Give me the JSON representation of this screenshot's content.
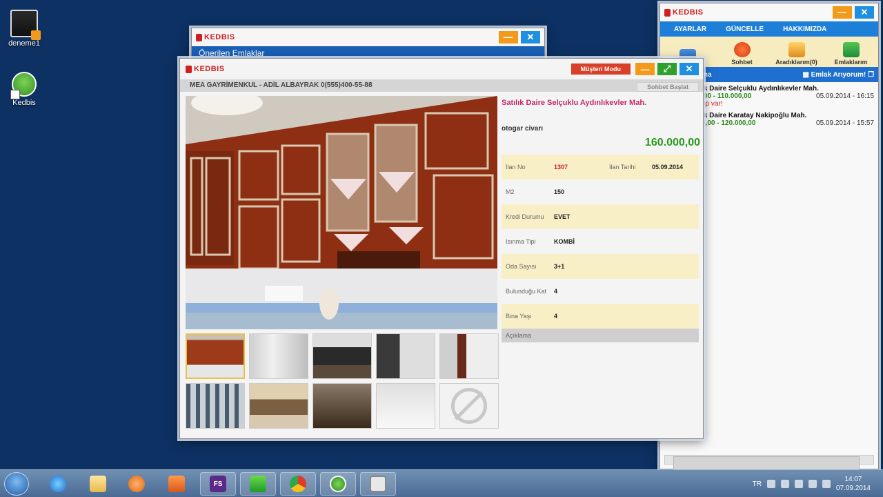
{
  "desktop": {
    "icons": [
      {
        "label": "deneme1",
        "icon": "video-file-icon"
      },
      {
        "label": "Kedbis",
        "icon": "kedbis-house-icon"
      }
    ]
  },
  "app_name": "KEDBIS",
  "back_window": {
    "subtitle": "Önerilen Emlaklar"
  },
  "right_window": {
    "menu": [
      "AYARLAR",
      "GÜNCELLE",
      "HAKKIMIZDA"
    ],
    "toolbar": [
      "",
      "Sohbet",
      "Aradıklarım(0)",
      "Emlaklarım"
    ],
    "list_header_left": "ma",
    "list_header_right": "Emlak Arıyorum!",
    "items": [
      {
        "title": "ık Daire Selçuklu Aydınlıkevler Mah.",
        "price": ",00 - 110.000,00",
        "date": "05.09.2014 - 16:15",
        "note": "ap var!"
      },
      {
        "title": "ık Daire Karatay Nakipoğlu Mah.",
        "price": "0,00 - 120.000,00",
        "date": "05.09.2014 - 15:57",
        "note": ""
      }
    ]
  },
  "main_window": {
    "musteri_modu": "Müşteri Modu",
    "agent": "MEA GAYRİMENKUL - ADİL ALBAYRAK 0(555)400-55-88",
    "sohbet_baslat": "Sohbet Başlat",
    "listing": {
      "title": "Satılık Daire Selçuklu Aydınlıkevler Mah.",
      "description": "otogar civarı",
      "price": "160.000,00",
      "ilan_no_label": "İlan No",
      "ilan_no": "1307",
      "ilan_tarihi_label": "İlan Tarihi",
      "ilan_tarihi": "05.09.2014",
      "rows": [
        {
          "label": "M2",
          "value": "150"
        },
        {
          "label": "Kredi Durumu",
          "value": "EVET"
        },
        {
          "label": "Isınma Tipi",
          "value": "KOMBİ"
        },
        {
          "label": "Oda Sayısı",
          "value": "3+1"
        },
        {
          "label": "Bulunduğu Kat",
          "value": "4"
        },
        {
          "label": "Bina Yaşı",
          "value": "4"
        }
      ],
      "aciklama_label": "Açıklama"
    }
  },
  "taskbar": {
    "language": "TR",
    "time": "14:07",
    "date": "07.09.2014"
  }
}
